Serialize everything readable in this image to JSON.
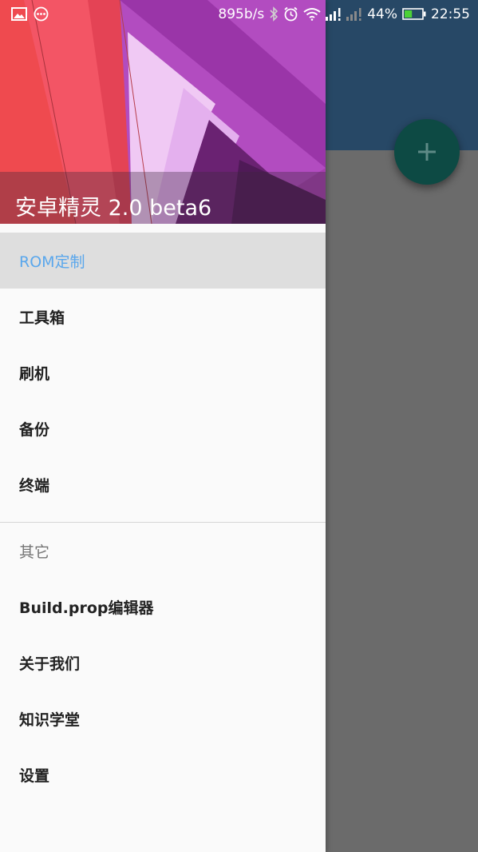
{
  "status_bar": {
    "network_speed": "895b/s",
    "battery_percent": "44%",
    "time": "22:55",
    "battery_level": 0.44
  },
  "drawer": {
    "title": "安卓精灵 2.0 beta6",
    "primary_items": [
      {
        "label": "ROM定制",
        "active": true
      },
      {
        "label": "工具箱"
      },
      {
        "label": "刷机"
      },
      {
        "label": "备份"
      },
      {
        "label": "终端"
      }
    ],
    "section_header": "其它",
    "secondary_items": [
      {
        "label": "Build.prop编辑器"
      },
      {
        "label": "关于我们"
      },
      {
        "label": "知识学堂"
      },
      {
        "label": "设置"
      }
    ]
  },
  "colors": {
    "toolbar": "#274866",
    "fab": "#0d4a44",
    "active_text": "#5aa7ec",
    "active_bg": "#dedede"
  },
  "icons": {
    "fab": "plus-icon"
  }
}
